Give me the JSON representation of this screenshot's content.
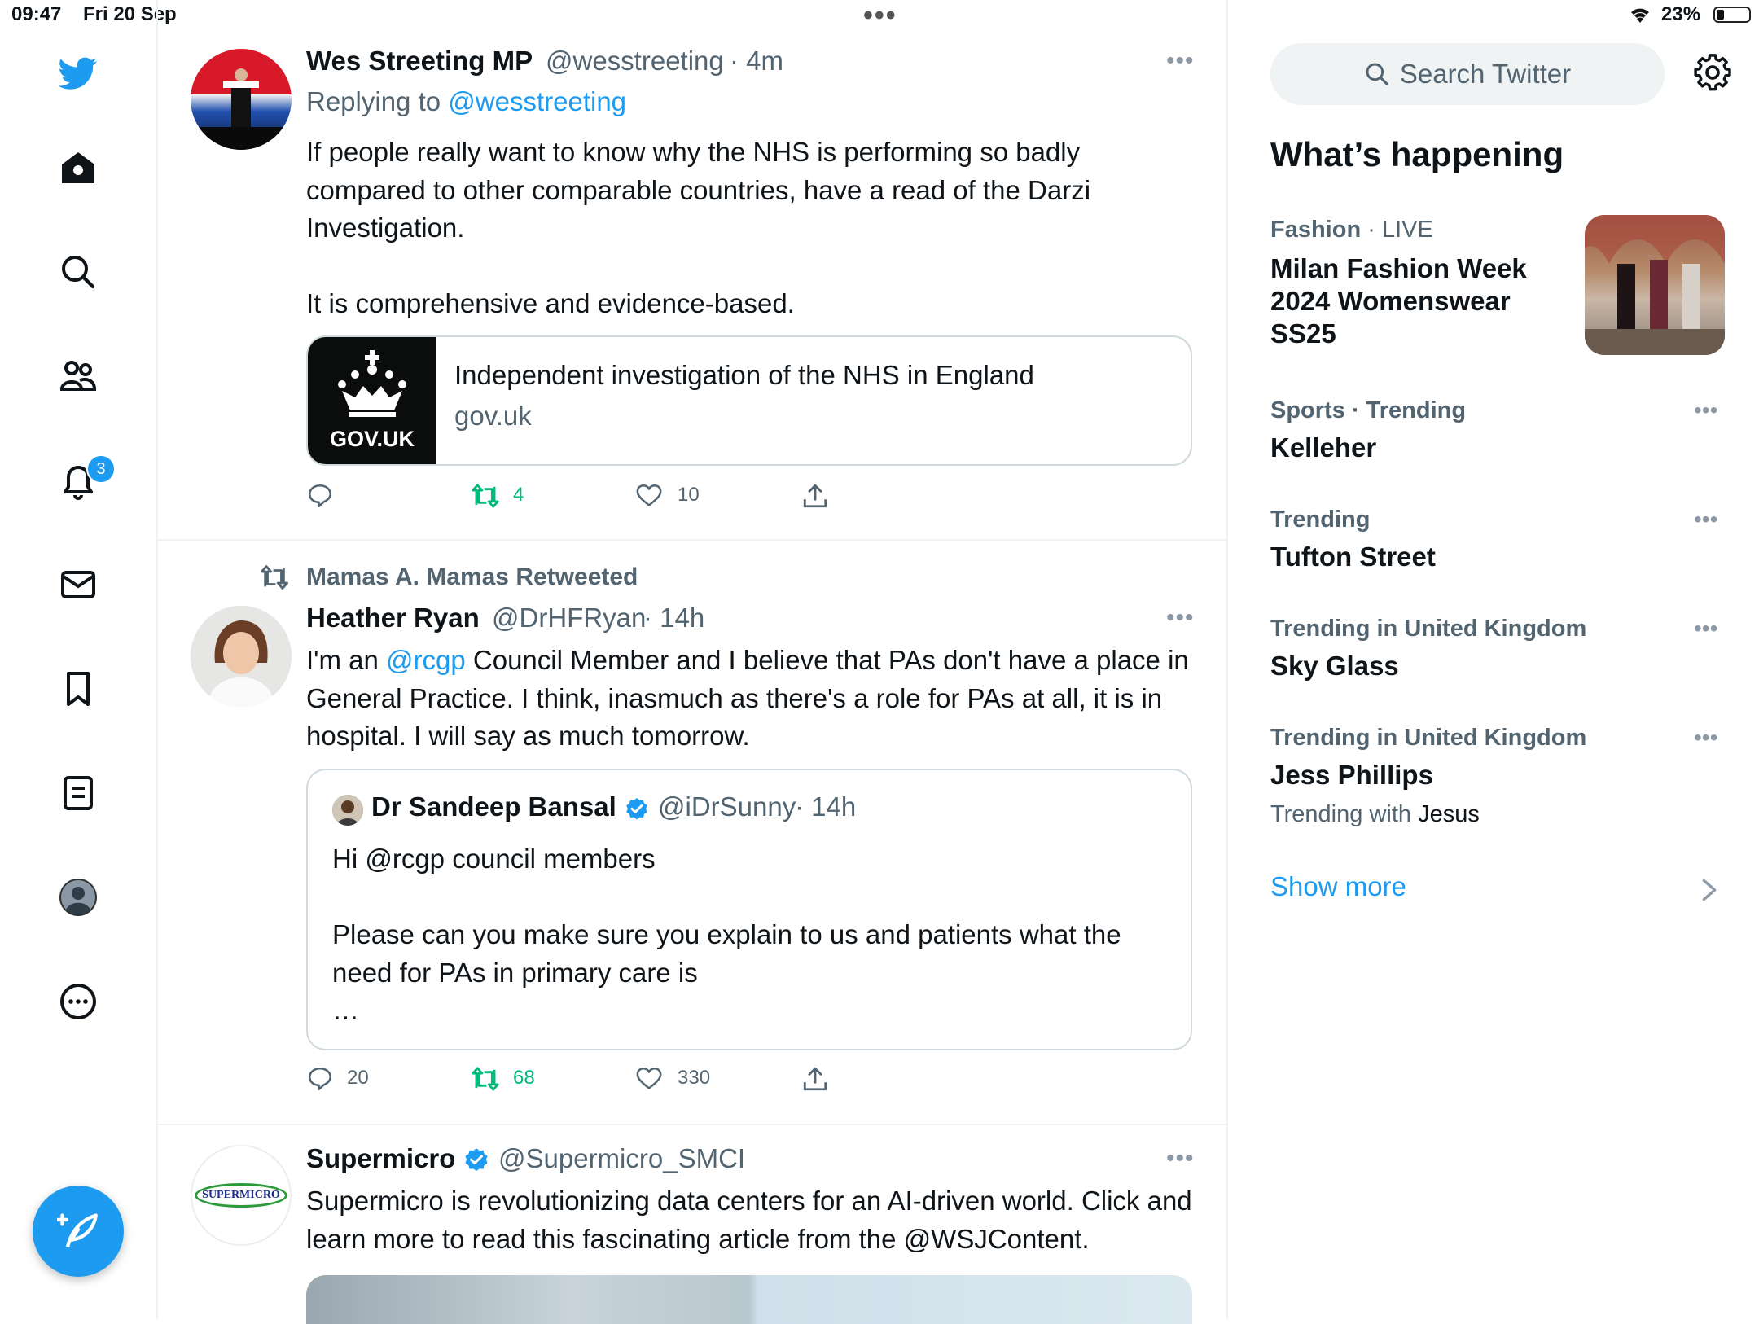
{
  "status_bar": {
    "time": "09:47",
    "date": "Fri 20 Sep",
    "battery": "23%",
    "battery_level": 0.23
  },
  "nav": {
    "notifications_badge": "3"
  },
  "tweets": [
    {
      "name": "Wes Streeting MP",
      "handle": "@wesstreeting",
      "time": "· 4m",
      "replying_prefix": "Replying to",
      "replying_to": "@wesstreeting",
      "text": "If people really want to know why the NHS is performing so badly compared to other comparable countries, have a read of the Darzi Investigation.\n\nIt is comprehensive and evidence-based.",
      "card": {
        "logo_text": "GOV.UK",
        "title": "Independent investigation of the NHS in England",
        "domain": "gov.uk"
      },
      "replies": "",
      "retweets": "4",
      "likes": "10"
    },
    {
      "retweeted_by": "Mamas A. Mamas Retweeted",
      "name": "Heather Ryan",
      "handle": "@DrHFRyan",
      "time": "· 14h",
      "text_before": "I'm an ",
      "mention": "@rcgp",
      "text_after": " Council Member and I believe that PAs don't have a place in General Practice. I think, inasmuch as there's a role for PAs at all, it is in hospital. I will say as much tomorrow.",
      "quote": {
        "name": "Dr Sandeep Bansal",
        "handle": "@iDrSunny",
        "time": "· 14h",
        "text": "Hi @rcgp council members\n\nPlease can you make sure you explain to us and patients what the need for PAs in primary care is\n…"
      },
      "replies": "20",
      "retweets": "68",
      "likes": "330"
    },
    {
      "name": "Supermicro",
      "handle": "@Supermicro_SMCI",
      "avatar_text": "SUPERMICRO",
      "text": "Supermicro is revolutionizing data centers for an AI-driven world. Click and learn more to read this fascinating article from the @WSJContent."
    }
  ],
  "right": {
    "search_placeholder": "Search Twitter",
    "title": "What’s happening",
    "trends": [
      {
        "category": "Fashion",
        "meta_suffix": " · LIVE",
        "name": "Milan Fashion Week 2024 Womenswear SS25"
      },
      {
        "category": "Sports · Trending",
        "name": "Kelleher"
      },
      {
        "category": "Trending",
        "name": "Tufton Street"
      },
      {
        "category": "Trending in United Kingdom",
        "name": "Sky Glass"
      },
      {
        "category": "Trending in United Kingdom",
        "name": "Jess Phillips",
        "with_prefix": "Trending with",
        "with_name": "Jesus"
      }
    ],
    "show_more": "Show more"
  },
  "colors": {
    "accent": "#1d9bf0",
    "retweet": "#00ba7c",
    "muted": "#536471"
  }
}
